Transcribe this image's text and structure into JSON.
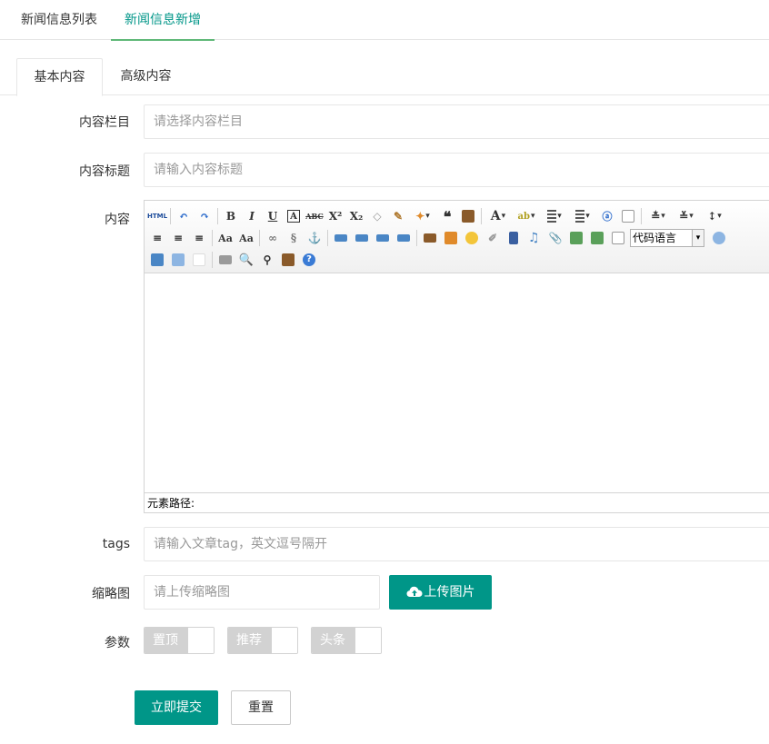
{
  "top_tabs": [
    {
      "label": "新闻信息列表",
      "active": false
    },
    {
      "label": "新闻信息新增",
      "active": true
    }
  ],
  "card_tabs": [
    {
      "label": "基本内容",
      "active": true
    },
    {
      "label": "高级内容",
      "active": false
    }
  ],
  "form": {
    "column": {
      "label": "内容栏目",
      "placeholder": "请选择内容栏目",
      "value": ""
    },
    "title": {
      "label": "内容标题",
      "placeholder": "请输入内容标题",
      "value": ""
    },
    "content": {
      "label": "内容"
    },
    "tags": {
      "label": "tags",
      "placeholder": "请输入文章tag，英文逗号隔开",
      "value": ""
    },
    "thumbnail": {
      "label": "缩略图",
      "placeholder": "请上传缩略图",
      "value": "",
      "upload_label": "上传图片"
    },
    "params": {
      "label": "参数",
      "switches": [
        {
          "label": "置顶",
          "on": false
        },
        {
          "label": "推荐",
          "on": false
        },
        {
          "label": "头条",
          "on": false
        }
      ]
    }
  },
  "editor": {
    "html_label": "HTML",
    "code_language": "代码语言",
    "element_path_label": "元素路径:"
  },
  "actions": {
    "submit_label": "立即提交",
    "reset_label": "重置"
  },
  "colors": {
    "primary": "#009688",
    "tab_underline": "#5fb878",
    "switch_off": "#d2d2d2"
  }
}
